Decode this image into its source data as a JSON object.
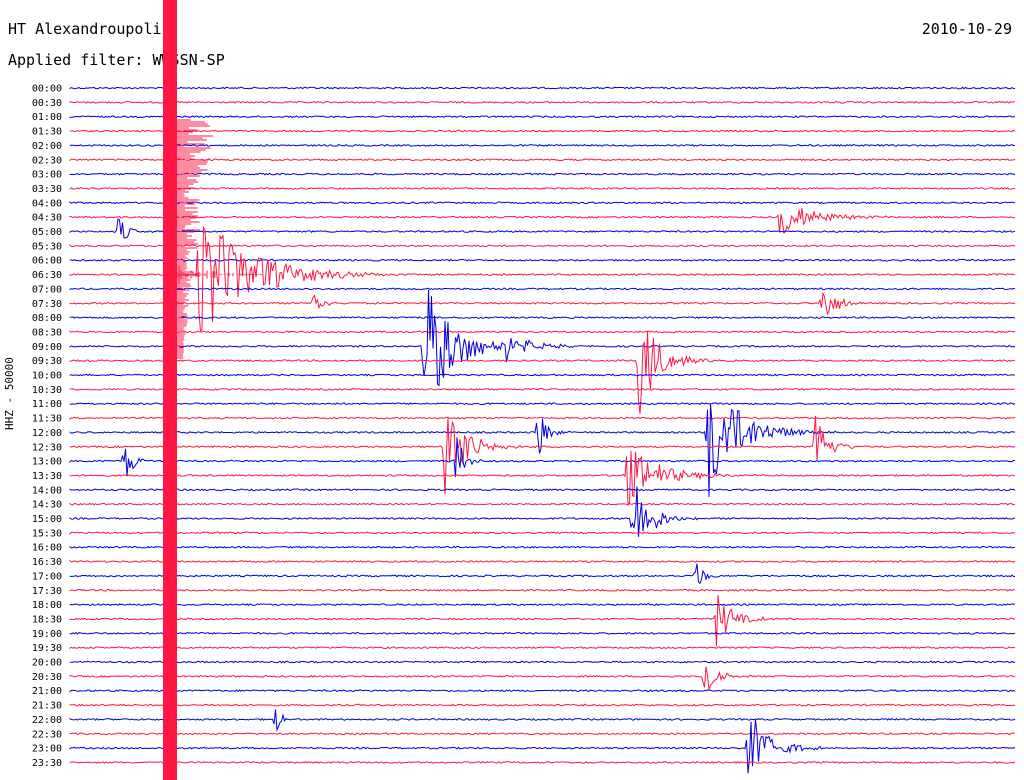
{
  "header": {
    "station": "HT Alexandroupoli",
    "date": "2010-10-29",
    "filter_label": "Applied filter: WWSSN-SP"
  },
  "chart_data": {
    "type": "line",
    "title": "HT Alexandroupoli",
    "ylabel": "HHZ - 50000",
    "row_labels": [
      "00:00",
      "00:30",
      "01:00",
      "01:30",
      "02:00",
      "02:30",
      "03:00",
      "03:30",
      "04:00",
      "04:30",
      "05:00",
      "05:30",
      "06:00",
      "06:30",
      "07:00",
      "07:30",
      "08:00",
      "08:30",
      "09:00",
      "09:30",
      "10:00",
      "10:30",
      "11:00",
      "11:30",
      "12:00",
      "12:30",
      "13:00",
      "13:30",
      "14:00",
      "14:30",
      "15:00",
      "15:30",
      "16:00",
      "16:30",
      "17:00",
      "17:30",
      "18:00",
      "18:30",
      "19:00",
      "19:30",
      "20:00",
      "20:30",
      "21:00",
      "21:30",
      "22:00",
      "22:30",
      "23:00",
      "23:30"
    ],
    "colors": {
      "even_rows": "#0000dd",
      "odd_rows": "#ff1744"
    },
    "minutes_per_row": 30,
    "events": [
      {
        "row": 13,
        "minute": 4.0,
        "amplitude": 1.0,
        "duration_min": 2.5
      },
      {
        "row": 18,
        "minute": 11.2,
        "amplitude": 1.0,
        "duration_min": 1.5
      },
      {
        "row": 25,
        "minute": 11.8,
        "amplitude": 0.8,
        "duration_min": 1.0
      },
      {
        "row": 26,
        "minute": 12.2,
        "amplitude": 0.5,
        "duration_min": 0.4
      },
      {
        "row": 24,
        "minute": 14.8,
        "amplitude": 0.6,
        "duration_min": 0.4
      },
      {
        "row": 19,
        "minute": 18.0,
        "amplitude": 0.9,
        "duration_min": 0.9
      },
      {
        "row": 27,
        "minute": 17.6,
        "amplitude": 0.5,
        "duration_min": 1.5
      },
      {
        "row": 30,
        "minute": 17.8,
        "amplitude": 0.8,
        "duration_min": 0.8
      },
      {
        "row": 24,
        "minute": 20.2,
        "amplitude": 1.0,
        "duration_min": 1.5
      },
      {
        "row": 25,
        "minute": 23.6,
        "amplitude": 0.6,
        "duration_min": 0.6
      },
      {
        "row": 34,
        "minute": 19.8,
        "amplitude": 0.3,
        "duration_min": 0.4
      },
      {
        "row": 37,
        "minute": 20.5,
        "amplitude": 0.4,
        "duration_min": 0.8
      },
      {
        "row": 41,
        "minute": 20.1,
        "amplitude": 0.5,
        "duration_min": 0.5
      },
      {
        "row": 46,
        "minute": 21.5,
        "amplitude": 0.6,
        "duration_min": 1.0
      },
      {
        "row": 15,
        "minute": 7.7,
        "amplitude": 0.35,
        "duration_min": 0.4
      },
      {
        "row": 10,
        "minute": 1.5,
        "amplitude": 0.3,
        "duration_min": 0.4
      },
      {
        "row": 26,
        "minute": 1.7,
        "amplitude": 0.4,
        "duration_min": 0.4
      },
      {
        "row": 44,
        "minute": 6.5,
        "amplitude": 0.25,
        "duration_min": 0.3
      },
      {
        "row": 9,
        "minute": 22.5,
        "amplitude": 0.3,
        "duration_min": 1.5
      },
      {
        "row": 15,
        "minute": 23.8,
        "amplitude": 0.4,
        "duration_min": 0.6
      },
      {
        "row": 18,
        "minute": 13.8,
        "amplitude": 0.25,
        "duration_min": 1.0
      }
    ]
  }
}
